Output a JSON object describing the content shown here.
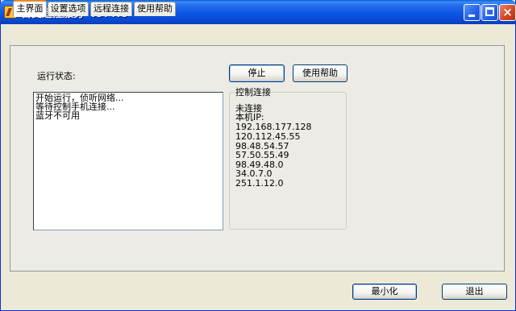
{
  "window": {
    "title": "百变遥控服务 v3.4.5",
    "icon": "app-icon",
    "controls": {
      "minimize": "minimize-icon",
      "maximize": "maximize-icon",
      "close": "×"
    }
  },
  "tabs": [
    {
      "label": "主界面",
      "active": true
    },
    {
      "label": "设置选项",
      "active": false
    },
    {
      "label": "远程连接",
      "active": false
    },
    {
      "label": "使用帮助",
      "active": false
    }
  ],
  "main": {
    "status_label": "运行状态:",
    "log_lines": [
      "开始运行，侦听网络...",
      "等待控制手机连接...",
      "蓝牙不可用"
    ],
    "stop_button": "停止",
    "help_button": "使用帮助",
    "control": {
      "title": "控制连接",
      "status": "未连接",
      "ip_label": "本机IP:",
      "ips": [
        "192.168.177.128",
        "120.112.45.55",
        "98.48.54.57",
        "57.50.55.49",
        "98.49.48.0",
        "34.0.7.0",
        "251.1.12.0"
      ]
    }
  },
  "footer": {
    "minimize_button": "最小化",
    "exit_button": "退出"
  },
  "colors": {
    "titlebar": "#0b56e4",
    "face": "#ece9d8",
    "tab_highlight": "#e68b2c"
  }
}
